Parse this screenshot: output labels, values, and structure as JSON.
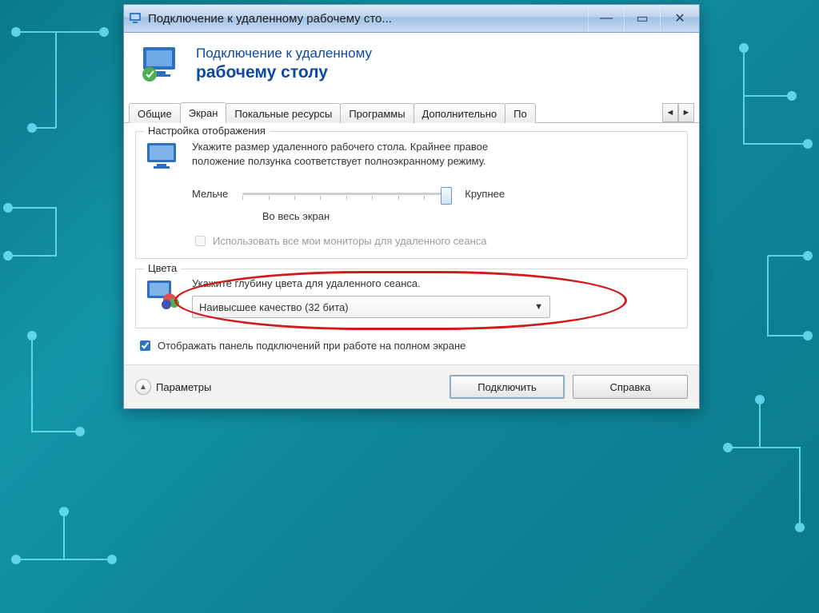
{
  "window": {
    "title": "Подключение к удаленному рабочему сто..."
  },
  "header": {
    "line1": "Подключение к удаленному",
    "line2": "рабочему столу"
  },
  "tabs": {
    "items": [
      {
        "label": "Общие"
      },
      {
        "label": "Экран"
      },
      {
        "label": "Покальные ресурсы"
      },
      {
        "label": "Программы"
      },
      {
        "label": "Дополнительно"
      },
      {
        "label": "По"
      }
    ],
    "active_index": 1
  },
  "display_group": {
    "legend": "Настройка отображения",
    "descr": "Укажите размер удаленного рабочего стола. Крайнее правое положение ползунка соответствует полноэкранному режиму.",
    "smaller": "Мельче",
    "larger": "Крупнее",
    "fullscreen_label": "Во весь экран",
    "use_all_monitors": "Использовать все мои мониторы для удаленного сеанса",
    "slider_value_percent": 100
  },
  "color_group": {
    "legend": "Цвета",
    "descr": "Укажите глубину цвета для удаленного сеанса.",
    "selected": "Наивысшее качество (32 бита)"
  },
  "footer": {
    "show_bar": "Отображать панель подключений при работе на полном экране",
    "params": "Параметры",
    "connect": "Подключить",
    "help": "Справка"
  }
}
